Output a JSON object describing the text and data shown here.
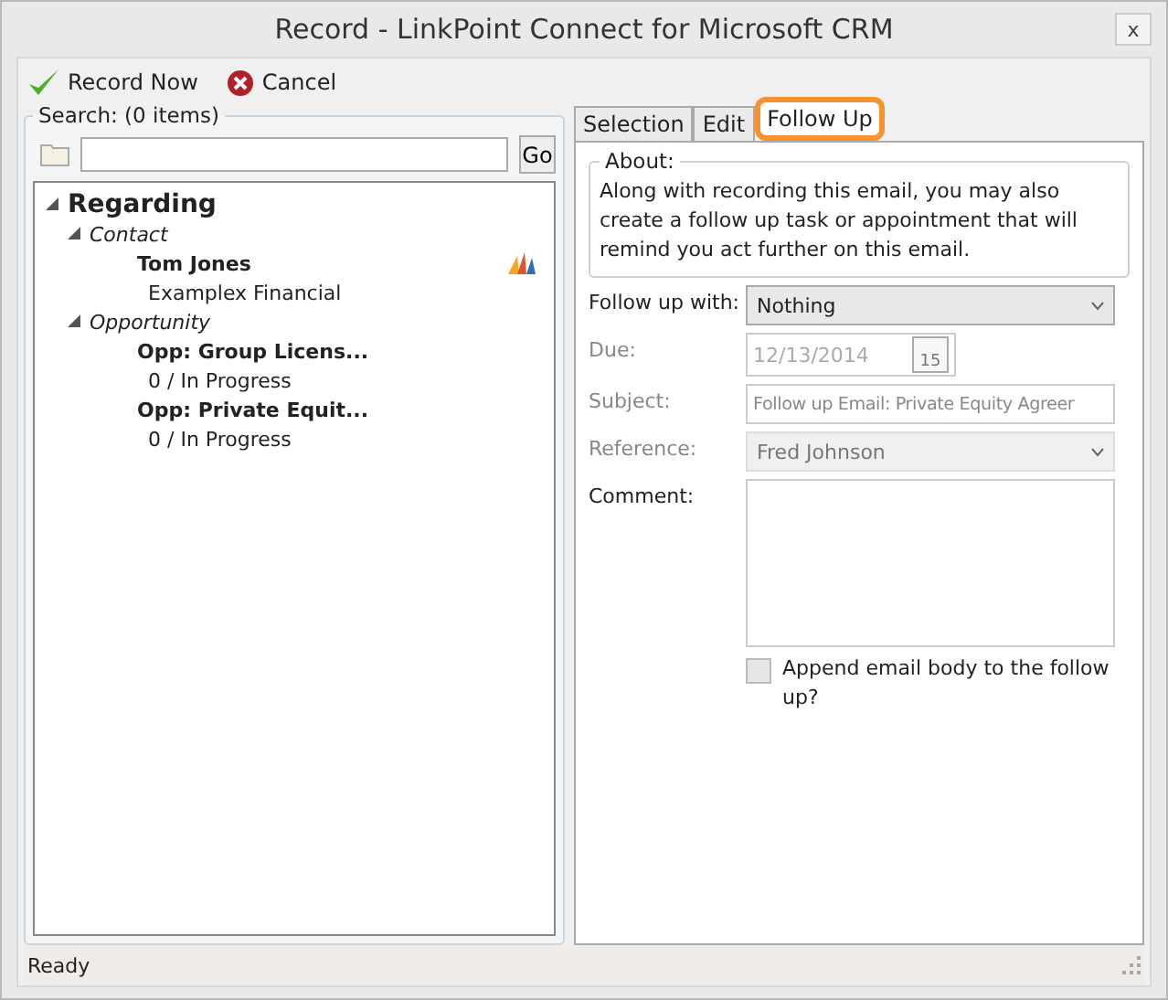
{
  "window": {
    "title": "Record - LinkPoint Connect for Microsoft CRM",
    "close": "x"
  },
  "toolbar": [
    {
      "label": "Record Now",
      "kind": "check"
    },
    {
      "label": "Cancel",
      "kind": "cancel"
    }
  ],
  "search": {
    "legend": "Search: (0 items)",
    "go": "Go"
  },
  "tree": {
    "label": "Regarding",
    "expanded": true,
    "groups": [
      {
        "label": "Contact",
        "expanded": true,
        "items": [
          {
            "title": "Tom Jones",
            "subtitle": "Examplex Financial",
            "crm_icon": true
          }
        ]
      },
      {
        "label": "Opportunity",
        "expanded": true,
        "items": [
          {
            "title": "Opp: Group Licens...",
            "subtitle": "0 / In Progress",
            "crm_icon": false
          },
          {
            "title": "Opp: Private Equit...",
            "subtitle": "0 / In Progress",
            "crm_icon": false
          }
        ]
      }
    ]
  },
  "tabs": [
    {
      "label": "Selection",
      "selected": false
    },
    {
      "label": "Edit",
      "selected": false
    },
    {
      "label": "Follow Up",
      "selected": true
    }
  ],
  "about": {
    "legend": "About:",
    "text": "Along with recording this email, you may also create a follow up task or appointment that will remind you act further on this email."
  },
  "fields": [
    {
      "kind": "select",
      "label": "Follow up with:",
      "value": "Nothing",
      "disabled": false
    },
    {
      "kind": "date",
      "label": "Due:",
      "value": "12/13/2014",
      "disabled": true,
      "calendar_day": "15"
    },
    {
      "kind": "text",
      "label": "Subject:",
      "value": "Follow up Email: Private Equity Agreer",
      "disabled": true
    },
    {
      "kind": "select",
      "label": "Reference:",
      "value": "Fred Johnson",
      "disabled": true
    },
    {
      "kind": "textarea",
      "label": "Comment:",
      "disabled": false
    }
  ],
  "append": {
    "label": "Append email body to the follow up?",
    "checked": false
  },
  "status": "Ready"
}
